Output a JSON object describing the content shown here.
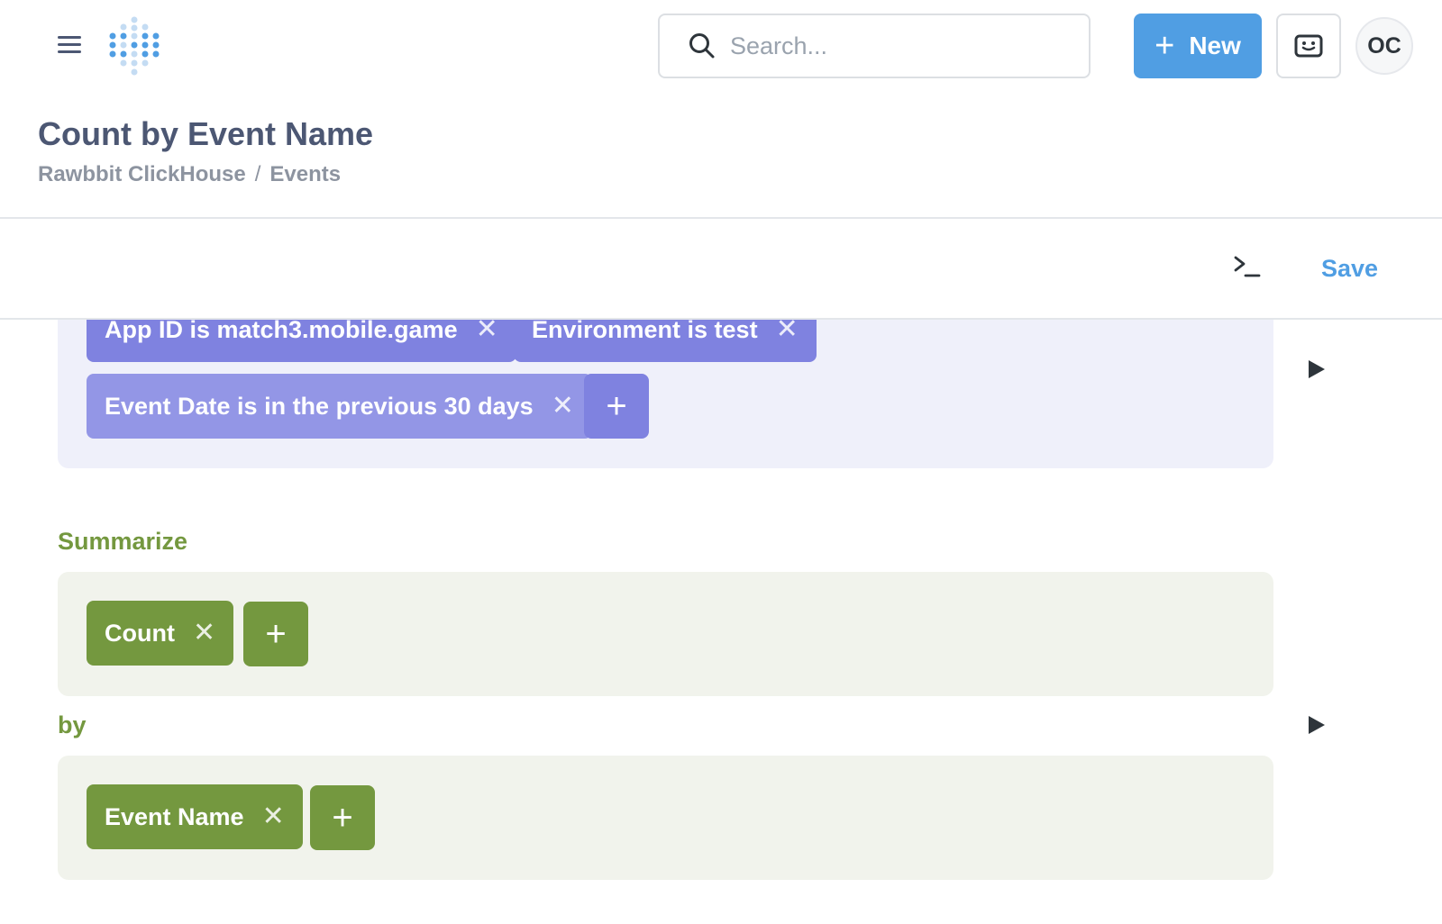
{
  "nav": {
    "search_placeholder": "Search...",
    "new_label": "New",
    "avatar_initials": "OC"
  },
  "header": {
    "title": "Count by Event Name",
    "breadcrumb": [
      "Rawbbit ClickHouse",
      "Events"
    ],
    "separator": "/"
  },
  "actions": {
    "save_label": "Save"
  },
  "filters": [
    "App ID is match3.mobile.game",
    "Environment is test",
    "Event Date is in the previous 30 days"
  ],
  "summarize": {
    "label": "Summarize",
    "metrics": [
      "Count"
    ]
  },
  "group_by": {
    "label": "by",
    "dimensions": [
      "Event Name"
    ]
  },
  "colors": {
    "brand": "#509ee3",
    "filter": "#7f82e0",
    "summarize": "#74983f"
  }
}
